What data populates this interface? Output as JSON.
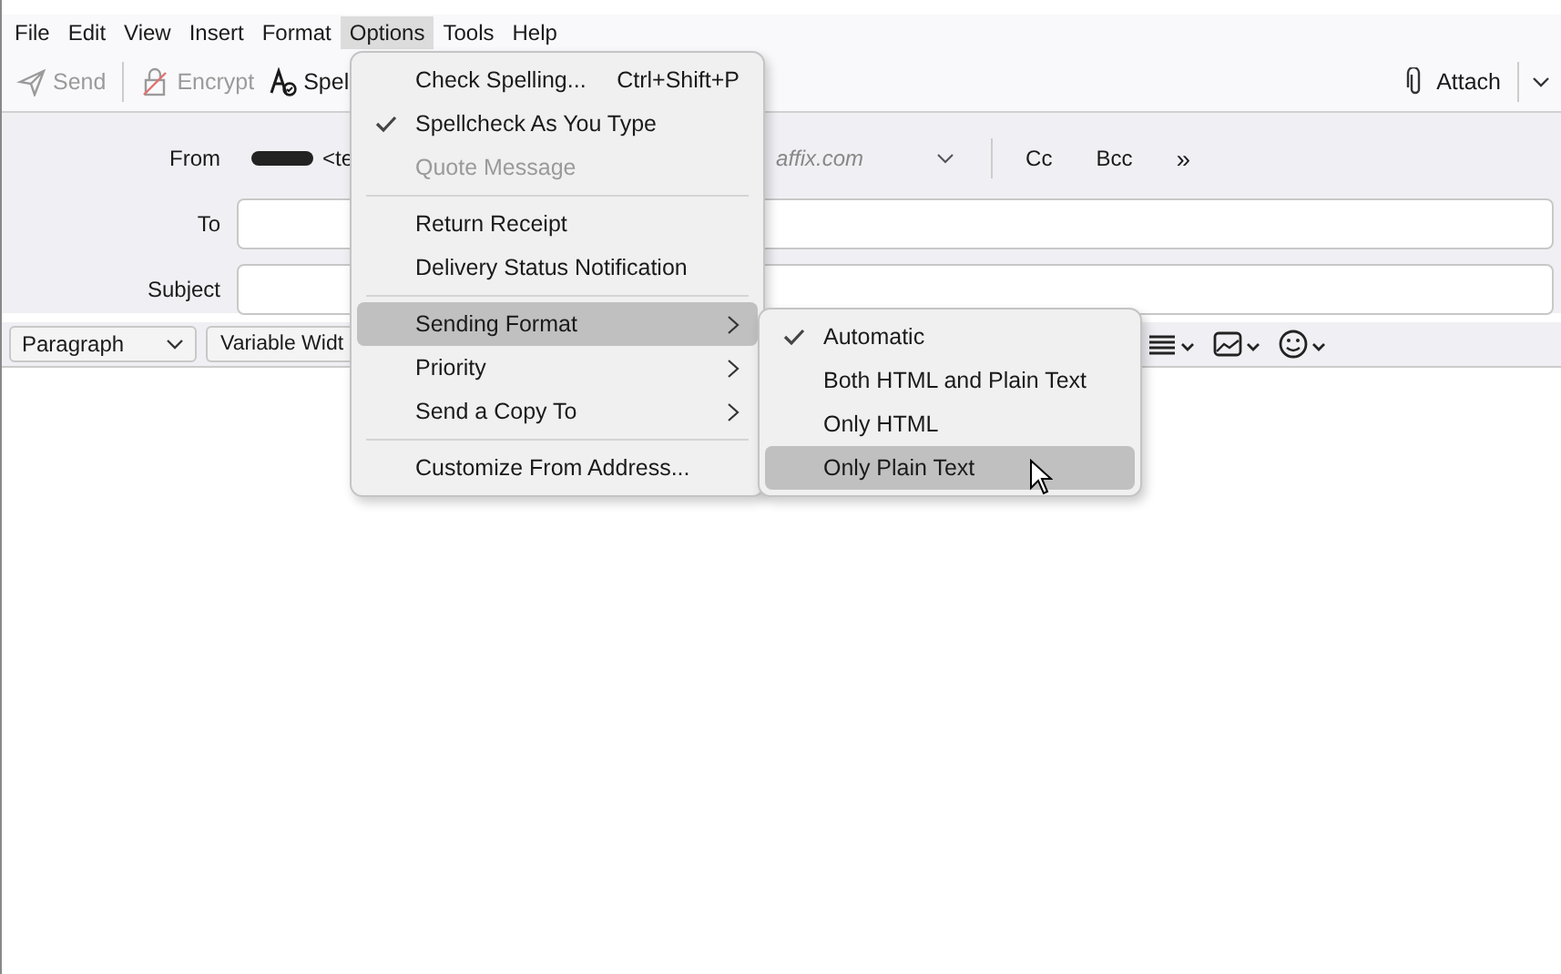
{
  "menubar": [
    {
      "label": "File",
      "selected": false
    },
    {
      "label": "Edit",
      "selected": false
    },
    {
      "label": "View",
      "selected": false
    },
    {
      "label": "Insert",
      "selected": false
    },
    {
      "label": "Format",
      "selected": false
    },
    {
      "label": "Options",
      "selected": true
    },
    {
      "label": "Tools",
      "selected": false
    },
    {
      "label": "Help",
      "selected": false
    }
  ],
  "toolbar": {
    "left": [
      {
        "label": "Send",
        "disabled": true
      },
      {
        "label": "Encrypt",
        "disabled": true
      },
      {
        "label": "Spel",
        "disabled": false
      }
    ],
    "attach": "Attach"
  },
  "header": {
    "from_label": "From",
    "from_visible_start": "<te",
    "from_visible_end": "affix.com",
    "cc": "Cc",
    "bcc": "Bcc",
    "more": "»",
    "to_label": "To",
    "subject_label": "Subject"
  },
  "format_toolbar": {
    "paragraph": "Paragraph",
    "font": "Variable Widt"
  },
  "options_menu": [
    {
      "kind": "item",
      "label": "Check Spelling...",
      "shortcut": "Ctrl+Shift+P",
      "checked": false,
      "disabled": false,
      "selected": false,
      "submenu": false
    },
    {
      "kind": "item",
      "label": "Spellcheck As You Type",
      "checked": true,
      "disabled": false,
      "selected": false,
      "submenu": false
    },
    {
      "kind": "item",
      "label": "Quote Message",
      "checked": false,
      "disabled": true,
      "selected": false,
      "submenu": false
    },
    {
      "kind": "separator"
    },
    {
      "kind": "item",
      "label": "Return Receipt",
      "checked": false,
      "disabled": false,
      "selected": false,
      "submenu": false
    },
    {
      "kind": "item",
      "label": "Delivery Status Notification",
      "checked": false,
      "disabled": false,
      "selected": false,
      "submenu": false
    },
    {
      "kind": "separator"
    },
    {
      "kind": "item",
      "label": "Sending Format",
      "checked": false,
      "disabled": false,
      "selected": true,
      "submenu": true
    },
    {
      "kind": "item",
      "label": "Priority",
      "checked": false,
      "disabled": false,
      "selected": false,
      "submenu": true
    },
    {
      "kind": "item",
      "label": "Send a Copy To",
      "checked": false,
      "disabled": false,
      "selected": false,
      "submenu": true
    },
    {
      "kind": "separator"
    },
    {
      "kind": "item",
      "label": "Customize From Address...",
      "checked": false,
      "disabled": false,
      "selected": false,
      "submenu": false
    }
  ],
  "sending_format_menu": [
    {
      "kind": "item",
      "label": "Automatic",
      "checked": true,
      "disabled": false,
      "selected": false,
      "submenu": false
    },
    {
      "kind": "item",
      "label": "Both HTML and Plain Text",
      "checked": false,
      "disabled": false,
      "selected": false,
      "submenu": false
    },
    {
      "kind": "item",
      "label": "Only HTML",
      "checked": false,
      "disabled": false,
      "selected": false,
      "submenu": false
    },
    {
      "kind": "item",
      "label": "Only Plain Text",
      "checked": false,
      "disabled": false,
      "selected": true,
      "submenu": false
    }
  ]
}
